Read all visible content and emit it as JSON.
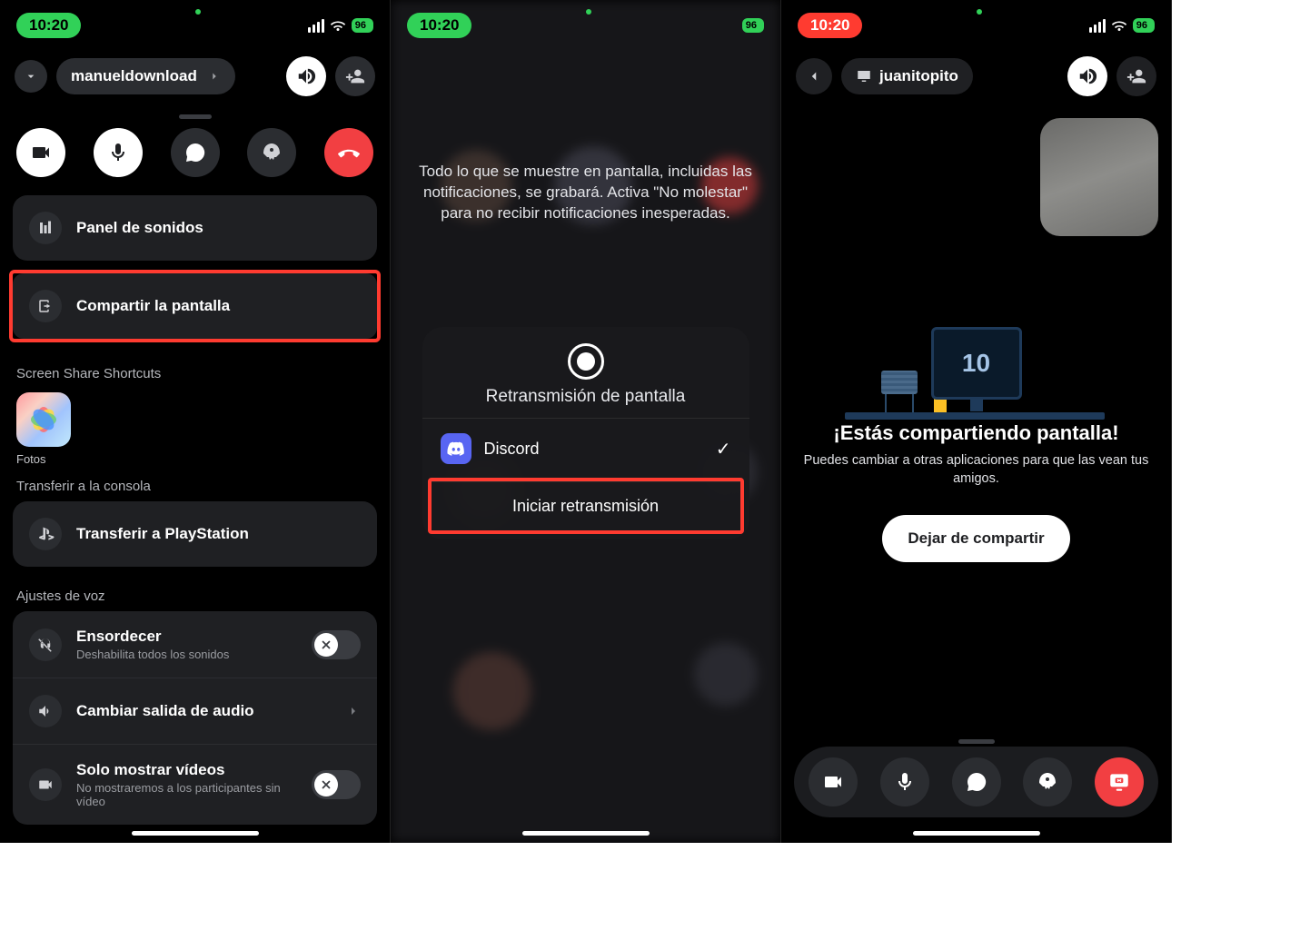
{
  "status": {
    "time": "10:20",
    "battery": "96"
  },
  "panel1": {
    "channel_name": "manueldownload",
    "actions": {
      "soundboard": "Panel de sonidos",
      "share_screen": "Compartir la pantalla"
    },
    "shortcuts_label": "Screen Share Shortcuts",
    "shortcut_app": "Fotos",
    "transfer_label": "Transferir a la consola",
    "transfer_ps": "Transferir a PlayStation",
    "voice_label": "Ajustes de voz",
    "deafen": {
      "title": "Ensordecer",
      "sub": "Deshabilita todos los sonidos"
    },
    "audio_out": "Cambiar salida de audio",
    "video_only": {
      "title": "Solo mostrar vídeos",
      "sub": "No mostraremos a los participantes sin vídeo"
    }
  },
  "panel2": {
    "warning": "Todo lo que se muestre en pantalla, incluidas las notificaciones, se grabará. Activa \"No molestar\" para no recibir notificaciones inesperadas.",
    "sheet_title": "Retransmisión de pantalla",
    "app_option": "Discord",
    "start_label": "Iniciar retransmisión"
  },
  "panel3": {
    "user": "juanitopito",
    "countdown": "10",
    "title": "¡Estás compartiendo pantalla!",
    "sub": "Puedes cambiar a otras aplicaciones para que las vean tus amigos.",
    "stop": "Dejar de compartir"
  }
}
